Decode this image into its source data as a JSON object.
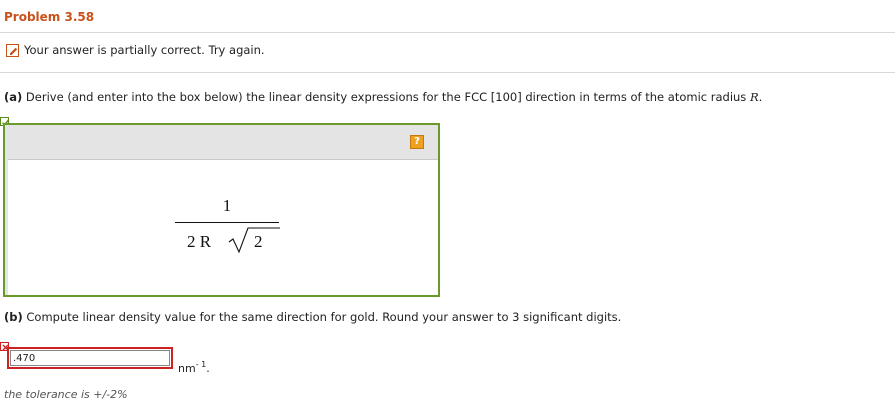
{
  "problem": {
    "title": "Problem 3.58"
  },
  "status": {
    "message": "Your answer is partially correct.  Try again.",
    "icon": "pencil-icon"
  },
  "part_a": {
    "label": "(a)",
    "text": " Derive (and enter into the box below) the linear density expressions for the FCC [100] direction in terms of the atomic radius ",
    "variable": "R",
    "end": ".",
    "answer_state": "correct",
    "help_label": "?",
    "expression": {
      "numerator": "1",
      "denominator_coefficient": "2 R",
      "denominator_radicand": "2"
    }
  },
  "part_b": {
    "label": "(b)",
    "text": " Compute linear density value for the same direction for gold. Round your answer to 3 significant digits.",
    "answer_state": "incorrect",
    "answer_value": ".470",
    "unit": "nm",
    "unit_exponent": "- 1",
    "unit_end": ".",
    "tolerance": "the tolerance is +/-2%"
  },
  "colors": {
    "title": "#c9521a",
    "correct_border": "#6a9a2a",
    "incorrect_border": "#cc2222",
    "help_button": "#f0a020"
  }
}
